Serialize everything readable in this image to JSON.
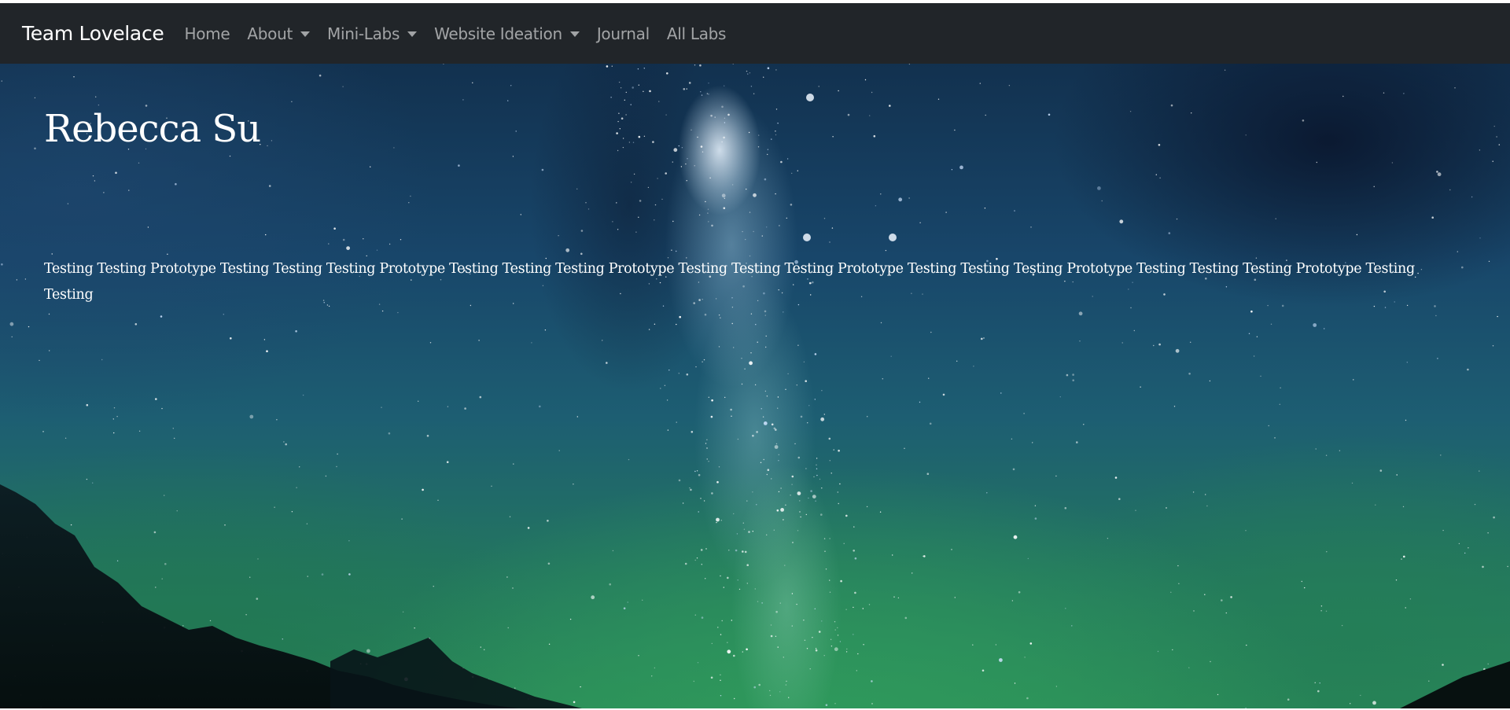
{
  "navbar": {
    "brand": "Team Lovelace",
    "items": [
      {
        "label": "Home",
        "dropdown": false
      },
      {
        "label": "About",
        "dropdown": true
      },
      {
        "label": "Mini-Labs",
        "dropdown": true
      },
      {
        "label": "Website Ideation",
        "dropdown": true
      },
      {
        "label": "Journal",
        "dropdown": false
      },
      {
        "label": "All Labs",
        "dropdown": false
      }
    ]
  },
  "hero": {
    "title": "Rebecca Su",
    "text": "Testing Testing Prototype Testing Testing Testing Prototype Testing Testing Testing Prototype Testing Testing Testing Prototype Testing Testing Testing Prototype Testing Testing Testing Prototype Testing Testing"
  },
  "colors": {
    "navbar_bg": "#212529",
    "nav_link": "rgba(255,255,255,0.58)",
    "brand_text": "#ffffff",
    "hero_text": "#ffffff"
  },
  "icons": {
    "dropdown": "caret-down-icon"
  }
}
